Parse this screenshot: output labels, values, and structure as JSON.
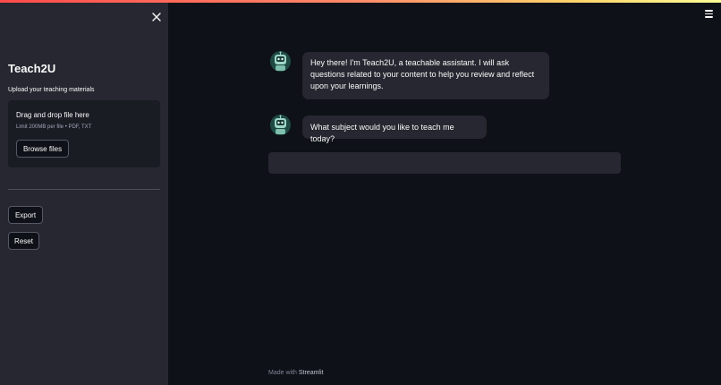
{
  "sidebar": {
    "title": "Teach2U",
    "upload_label": "Upload your teaching materials",
    "dropzone": {
      "title": "Drag and drop file here",
      "hint": "Limit 200MB per file • PDF, TXT",
      "browse_label": "Browse files"
    },
    "export_label": "Export",
    "reset_label": "Reset"
  },
  "chat": {
    "messages": [
      {
        "role": "assistant",
        "text": "Hey there! I'm Teach2U, a teachable assistant. I will ask questions related to your content to help you review and reflect upon your learnings."
      },
      {
        "role": "assistant",
        "text": "What subject would you like to teach me today?"
      }
    ],
    "input_placeholder": ""
  },
  "footer": {
    "prefix": "Made with ",
    "brand": "Streamlit"
  },
  "icons": {
    "close": "close-icon",
    "menu": "hamburger-menu-icon",
    "avatar": "robot-avatar-icon"
  },
  "colors": {
    "background": "#0e1117",
    "sidebar": "#262730",
    "bubble": "#262730",
    "accent": "#ff4b4b",
    "avatar_bg": "#1f4a43"
  }
}
